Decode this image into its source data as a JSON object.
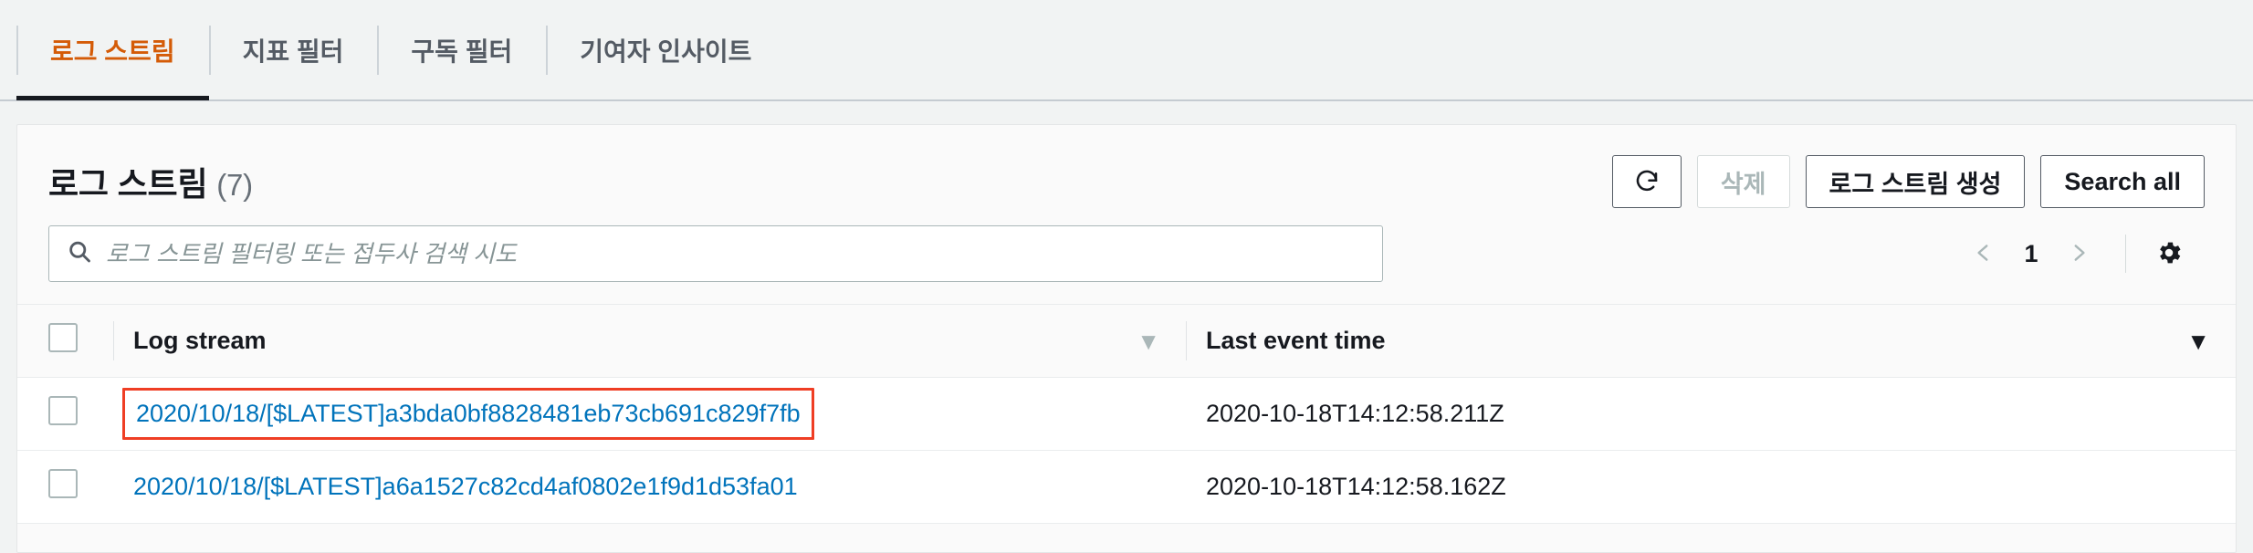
{
  "tabs": [
    {
      "label": "로그 스트림",
      "active": true
    },
    {
      "label": "지표 필터",
      "active": false
    },
    {
      "label": "구독 필터",
      "active": false
    },
    {
      "label": "기여자 인사이트",
      "active": false
    }
  ],
  "panel": {
    "title": "로그 스트림",
    "count": "(7)"
  },
  "actions": {
    "refresh_icon": "refresh-icon",
    "delete_label": "삭제",
    "create_label": "로그 스트림 생성",
    "search_all_label": "Search all"
  },
  "search": {
    "placeholder": "로그 스트림 필터링 또는 접두사 검색 시도",
    "value": "",
    "icon": "search-icon"
  },
  "pagination": {
    "prev_icon": "chevron-left-icon",
    "page": "1",
    "next_icon": "chevron-right-icon",
    "settings_icon": "gear-icon"
  },
  "table": {
    "columns": [
      {
        "key": "select",
        "label": ""
      },
      {
        "key": "log_stream",
        "label": "Log stream",
        "sort": "inactive"
      },
      {
        "key": "last_event_time",
        "label": "Last event time",
        "sort": "active-desc"
      }
    ],
    "rows": [
      {
        "log_stream": "2020/10/18/[$LATEST]a3bda0bf8828481eb73cb691c829f7fb",
        "last_event_time": "2020-10-18T14:12:58.211Z",
        "highlighted": true
      },
      {
        "log_stream": "2020/10/18/[$LATEST]a6a1527c82cd4af0802e1f9d1d53fa01",
        "last_event_time": "2020-10-18T14:12:58.162Z",
        "highlighted": false
      }
    ]
  },
  "colors": {
    "active_tab_text": "#d45b07",
    "active_tab_underline": "#16191f",
    "link": "#0073bb",
    "highlight_border": "#ef3e24",
    "page_background": "#f1f3f3"
  }
}
